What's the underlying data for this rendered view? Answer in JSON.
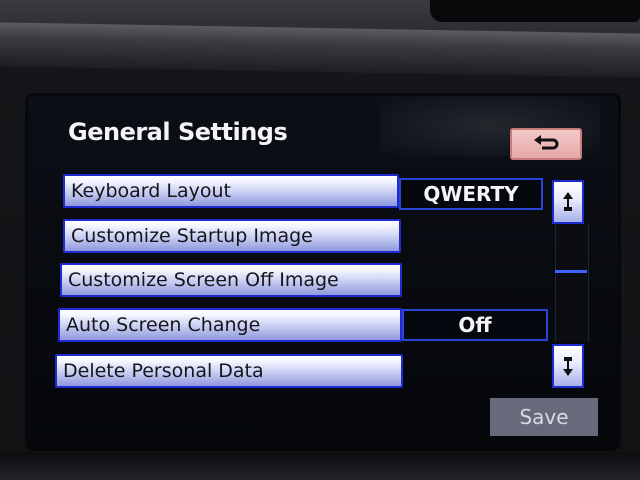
{
  "screen": {
    "title": "General Settings"
  },
  "back_button": {
    "icon": "back-arrow-icon"
  },
  "menu": {
    "items": [
      {
        "label": "Keyboard Layout",
        "value": "QWERTY"
      },
      {
        "label": "Customize Startup Image"
      },
      {
        "label": "Customize Screen Off Image"
      },
      {
        "label": "Auto Screen Change",
        "value": "Off"
      },
      {
        "label": "Delete Personal Data"
      }
    ]
  },
  "scrollbar": {
    "up_icon": "scroll-up-icon",
    "down_icon": "scroll-down-icon"
  },
  "actions": {
    "save_label": "Save"
  },
  "colors": {
    "accent_blue": "#1d2bd0",
    "back_button_pink": "#e4a8a7"
  }
}
